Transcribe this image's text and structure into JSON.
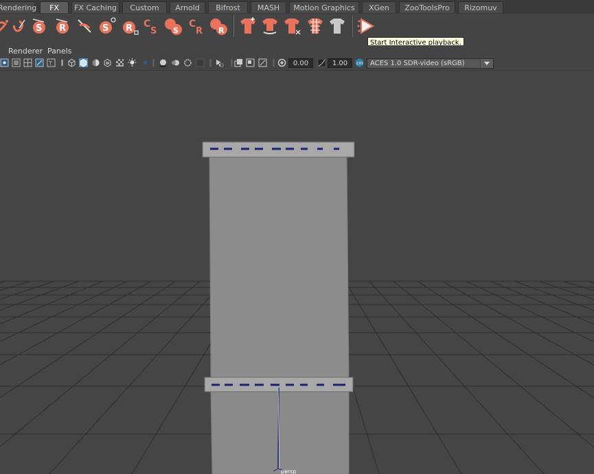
{
  "shelf_tabs": [
    {
      "label": "Rendering",
      "active": false
    },
    {
      "label": "FX",
      "active": true
    },
    {
      "label": "FX Caching",
      "active": false
    },
    {
      "label": "Custom",
      "active": false
    },
    {
      "label": "Arnold",
      "active": false
    },
    {
      "label": "Bifrost",
      "active": false
    },
    {
      "label": "MASH",
      "active": false
    },
    {
      "label": "Motion Graphics",
      "active": false
    },
    {
      "label": "XGen",
      "active": false
    },
    {
      "label": "ZooToolsPro",
      "active": false
    },
    {
      "label": "Rizomuv",
      "active": false
    }
  ],
  "shelf_icons": {
    "icon_color": "#e8735a",
    "items": [
      {
        "name": "nparticle-tool-icon",
        "glyph": ""
      },
      {
        "name": "emitter-icon",
        "glyph": ""
      },
      {
        "name": "soft-body-icon",
        "glyph": "S"
      },
      {
        "name": "rigid-body-icon",
        "glyph": "R"
      },
      {
        "name": "field-icon",
        "glyph": ""
      },
      {
        "name": "soft-constraint-icon",
        "glyph": "S"
      },
      {
        "name": "rigid-constraint-icon",
        "glyph": "R"
      },
      {
        "name": "create-soft-icon",
        "glyph": "CS"
      },
      {
        "name": "cs-icon",
        "glyph": "CS"
      },
      {
        "name": "create-rigid-icon",
        "glyph": "CR"
      },
      {
        "name": "cr-icon",
        "glyph": "CR"
      }
    ],
    "cloth_items": [
      {
        "name": "create-ncloth-icon"
      },
      {
        "name": "ncloth-collide-icon"
      },
      {
        "name": "remove-ncloth-icon"
      },
      {
        "name": "ncloth-mesh-icon"
      },
      {
        "name": "ncloth-plain-icon"
      }
    ],
    "play_button": {
      "name": "interactive-playback-icon"
    }
  },
  "tooltip": "Start Interactive playback.",
  "panel_menu": {
    "renderer": "Renderer",
    "panels": "Panels"
  },
  "panel_toolbar": {
    "exposure": "0.00",
    "gamma": "1.00",
    "color_space": "ACES 1.0 SDR-video (sRGB)"
  },
  "viewport": {
    "camera_label": "persp",
    "background_color": "#454545",
    "grid_color": "#2e2e2e",
    "mesh_color": "#8a8a8a",
    "edge_color": "#1b1f6e"
  }
}
